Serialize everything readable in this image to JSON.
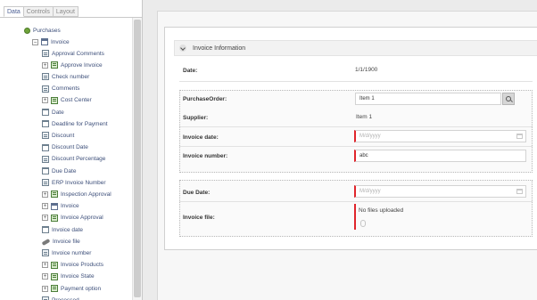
{
  "tabs": [
    "Data",
    "Controls",
    "Layout"
  ],
  "tree": {
    "root": "Purchases",
    "entity": "Invoice",
    "items": [
      {
        "label": "Approval Comments",
        "icon": "field-icon",
        "expander": false,
        "indent": 0
      },
      {
        "label": "Approve Invoice",
        "icon": "entity-icon",
        "expander": true,
        "indent": 1
      },
      {
        "label": "Check number",
        "icon": "field-icon",
        "expander": false,
        "indent": 0
      },
      {
        "label": "Comments",
        "icon": "field-icon",
        "expander": false,
        "indent": 0
      },
      {
        "label": "Cost Center",
        "icon": "entity-icon",
        "expander": true,
        "indent": 1
      },
      {
        "label": "Date",
        "icon": "date-icon",
        "expander": false,
        "indent": 0
      },
      {
        "label": "Deadline for Payment",
        "icon": "date-icon",
        "expander": false,
        "indent": 0
      },
      {
        "label": "Discount",
        "icon": "field-icon",
        "expander": false,
        "indent": 0
      },
      {
        "label": "Discount Date",
        "icon": "date-icon",
        "expander": false,
        "indent": 0
      },
      {
        "label": "Discount Percentage",
        "icon": "field-icon",
        "expander": false,
        "indent": 0
      },
      {
        "label": "Due Date",
        "icon": "date-icon",
        "expander": false,
        "indent": 0
      },
      {
        "label": "ERP Invoice Number",
        "icon": "field-icon",
        "expander": false,
        "indent": 0
      },
      {
        "label": "Inspection Approval",
        "icon": "entity-icon",
        "expander": true,
        "indent": 1
      },
      {
        "label": "Invoice",
        "icon": "table-icon",
        "expander": true,
        "indent": 1
      },
      {
        "label": "Invoice Approval",
        "icon": "entity-icon",
        "expander": true,
        "indent": 1
      },
      {
        "label": "Invoice date",
        "icon": "date-icon",
        "expander": false,
        "indent": 0
      },
      {
        "label": "Invoice file",
        "icon": "file-icon",
        "expander": false,
        "indent": 0
      },
      {
        "label": "Invoice number",
        "icon": "field-icon",
        "expander": false,
        "indent": 0
      },
      {
        "label": "Invoice Products",
        "icon": "entity-icon",
        "expander": true,
        "indent": 1
      },
      {
        "label": "Invoice State",
        "icon": "entity-icon",
        "expander": true,
        "indent": 1
      },
      {
        "label": "Payment option",
        "icon": "entity-icon",
        "expander": true,
        "indent": 1
      },
      {
        "label": "Processed",
        "icon": "field-icon",
        "expander": false,
        "indent": 0
      }
    ]
  },
  "form": {
    "section_title": "Invoice Information",
    "date_label": "Date:",
    "date_value": "1/1/1900",
    "purchase_order_label": "PurchaseOrder:",
    "purchase_order_value": "Item 1",
    "supplier_label": "Supplier:",
    "supplier_value": "Item 1",
    "invoice_date_label": "Invoice date:",
    "invoice_date_placeholder": "M/d/yyyy",
    "invoice_number_label": "Invoice number:",
    "invoice_number_value": "abc",
    "due_date_label": "Due Date:",
    "due_date_placeholder": "M/d/yyyy",
    "invoice_file_label": "Invoice file:",
    "invoice_file_status": "No files uploaded"
  },
  "colors": {
    "required_marker": "#e0252b",
    "active_tab_text": "#4b5e94",
    "tree_text": "#3d4f7a"
  }
}
